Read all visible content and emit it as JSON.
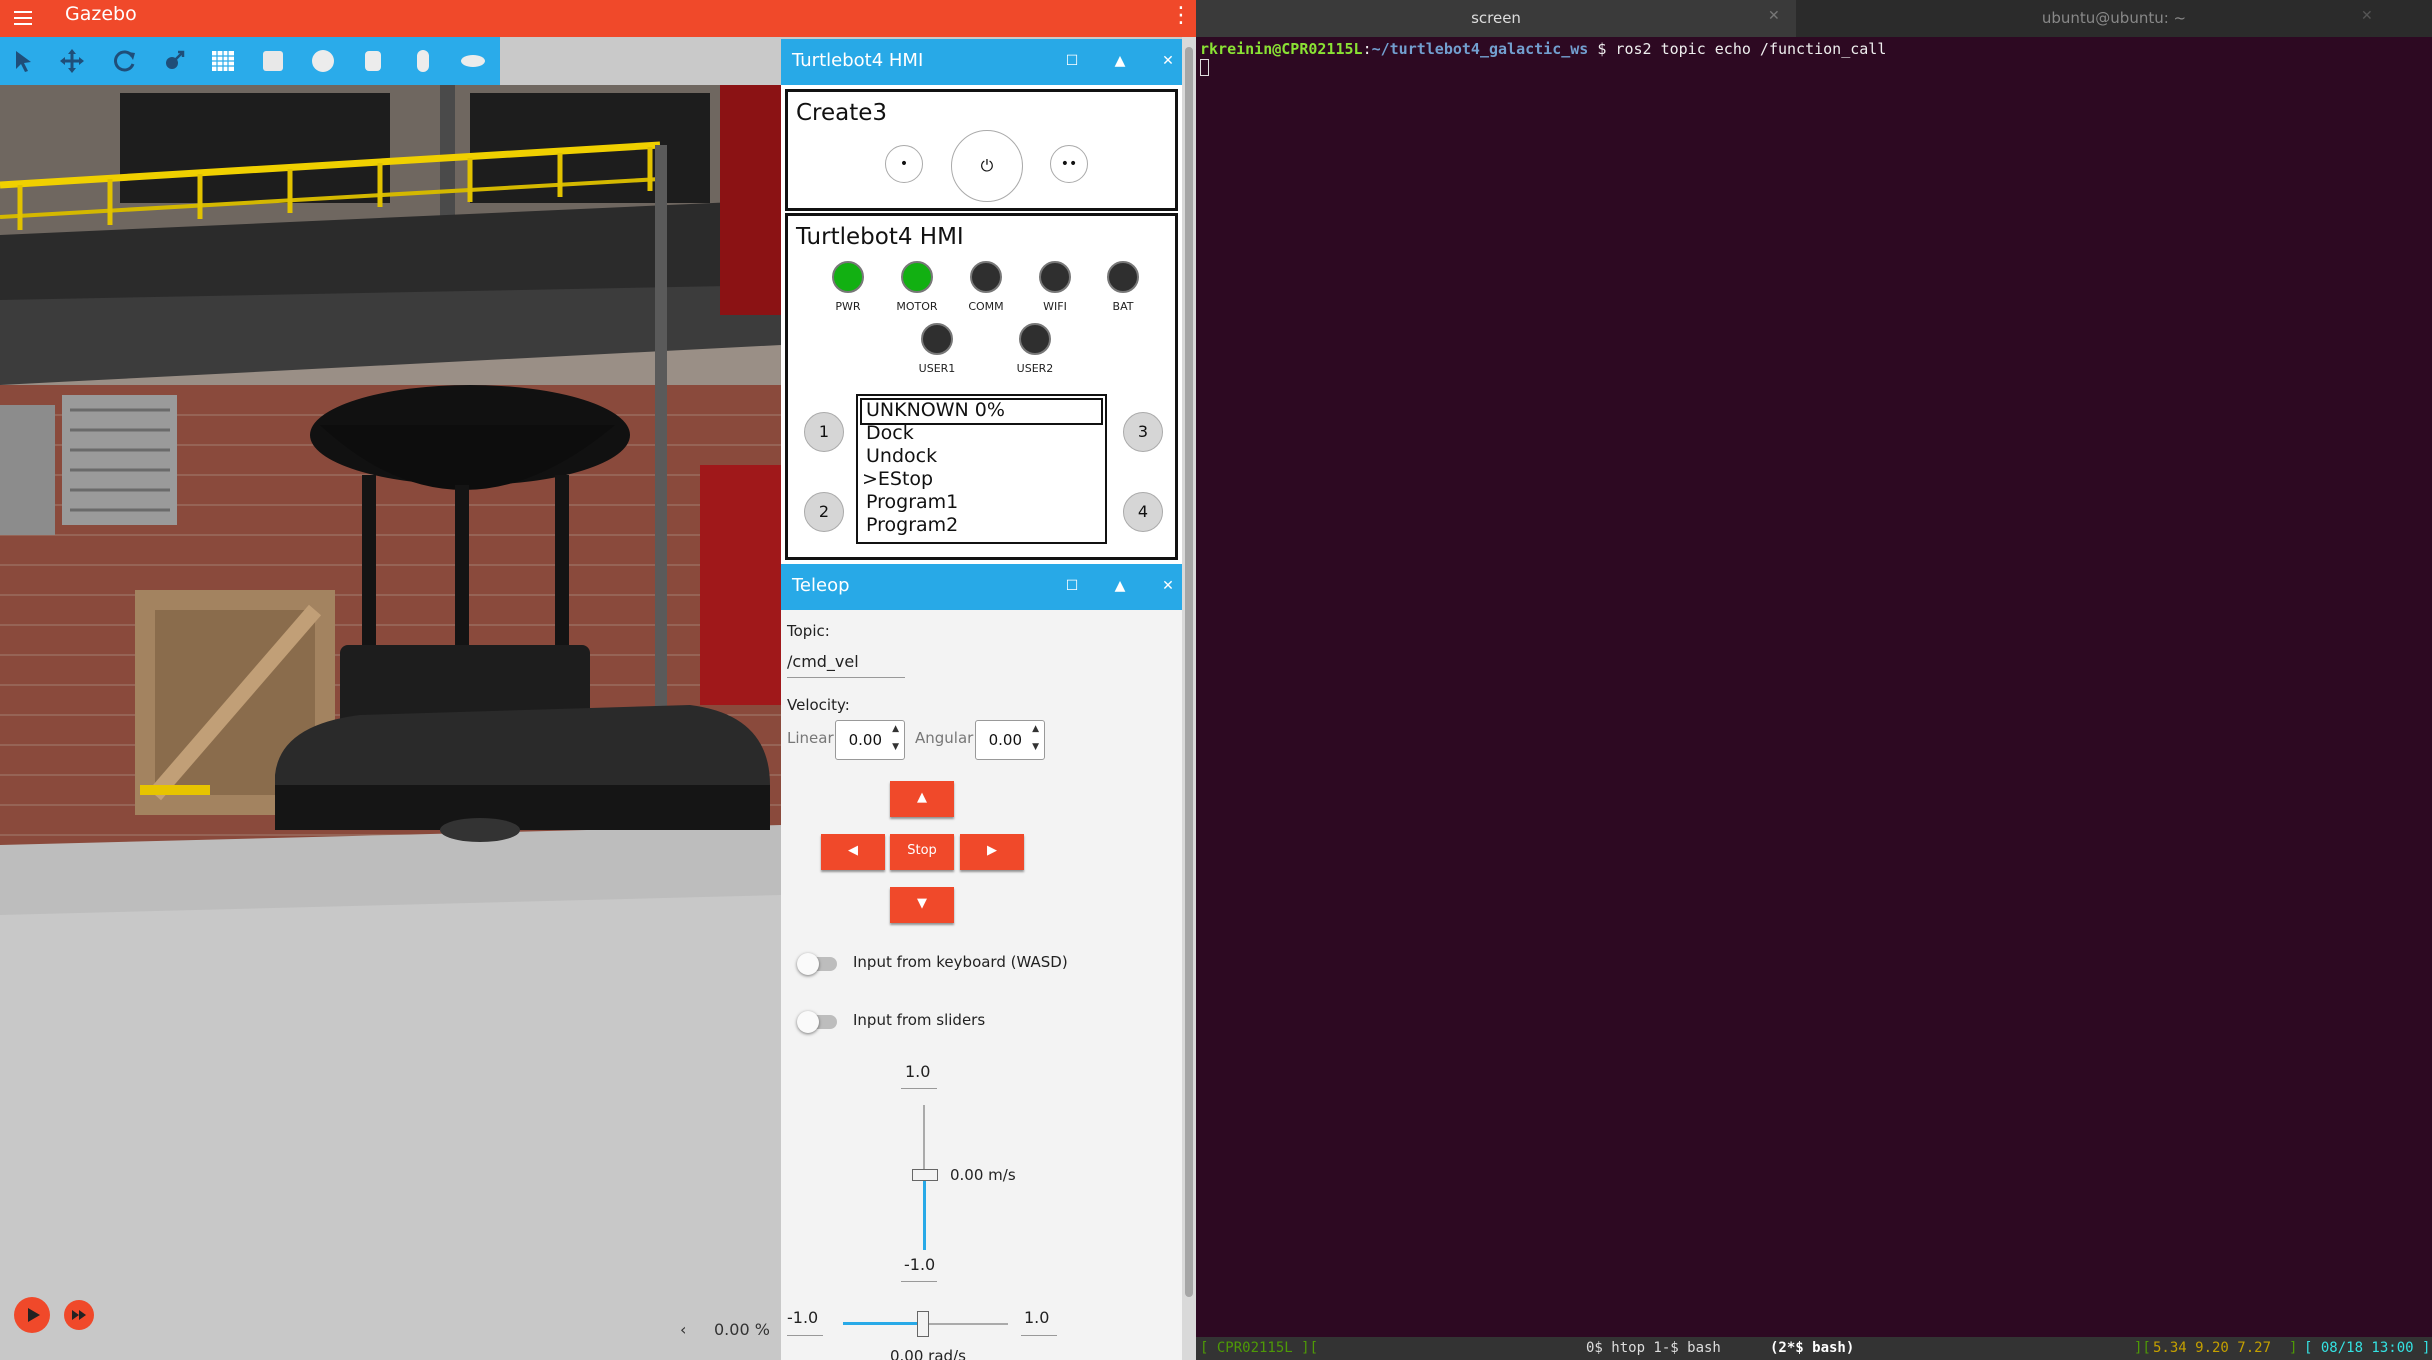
{
  "gazebo": {
    "title": "Gazebo",
    "toolbar": [
      "select-tool-icon",
      "translate-tool-icon",
      "rotate-tool-icon",
      "scale-tool-icon",
      "grid-icon",
      "box-shape-icon",
      "sphere-shape-icon",
      "cylinder-shape-icon",
      "capsule-shape-icon",
      "ellipsoid-shape-icon"
    ],
    "rtf": "0.00 %",
    "chevron": "‹"
  },
  "hmi": {
    "panel_title": "Turtlebot4 HMI",
    "create3_title": "Create3",
    "create3_buttons": {
      "left": "•",
      "power": "⏻",
      "right": "••"
    },
    "title": "Turtlebot4 HMI",
    "leds": [
      {
        "label": "PWR",
        "color": "#12b012"
      },
      {
        "label": "MOTOR",
        "color": "#12b012"
      },
      {
        "label": "COMM",
        "color": "#2f2f2f"
      },
      {
        "label": "WIFI",
        "color": "#2f2f2f"
      },
      {
        "label": "BAT",
        "color": "#2f2f2f"
      },
      {
        "label": "USER1",
        "color": "#2f2f2f"
      },
      {
        "label": "USER2",
        "color": "#2f2f2f"
      }
    ],
    "buttons": [
      "1",
      "2",
      "3",
      "4"
    ],
    "display": [
      "UNKNOWN 0%",
      "Dock",
      "Undock",
      ">EStop",
      "Program1",
      "Program2"
    ]
  },
  "teleop": {
    "panel_title": "Teleop",
    "topic_label": "Topic:",
    "topic_value": "/cmd_vel",
    "velocity_label": "Velocity:",
    "linear_label": "Linear",
    "linear_value": "0.00",
    "angular_label": "Angular",
    "angular_value": "0.00",
    "up": "▲",
    "down": "▼",
    "left": "◀",
    "right": "▶",
    "stop": "Stop",
    "keyboard_label": "Input from keyboard (WASD)",
    "sliders_label": "Input from sliders",
    "vslider_max": "1.0",
    "vslider_min": "-1.0",
    "vslider_value": "0.00 m/s",
    "hslider_min": "-1.0",
    "hslider_max": "1.0",
    "hslider_value": "0.00 rad/s"
  },
  "terminal": {
    "tab_screen": "screen",
    "tab_ubuntu": "ubuntu@ubuntu: ~",
    "prompt_user": "rkreinin@CPR02115L",
    "prompt_sep": ":",
    "prompt_path": "~/turtlebot4_galactic_ws",
    "prompt_cmd": " $ ros2 topic echo /function_call",
    "status": {
      "host": "[ CPR02115L ][",
      "windows_a": "0$ htop  1-$ bash  ",
      "active_window": "(2*$ bash)",
      "load_open": "][",
      "load": "5.34 9.20 7.27",
      "load_close": "]",
      "datetime": "[ 08/18 13:00 ]"
    }
  },
  "colors": {
    "gazebo_accent": "#f0492a",
    "panel_header": "#28a9e7",
    "terminal_bg": "#2d0922",
    "prompt_green": "#8ae234",
    "prompt_blue": "#729fcf"
  }
}
